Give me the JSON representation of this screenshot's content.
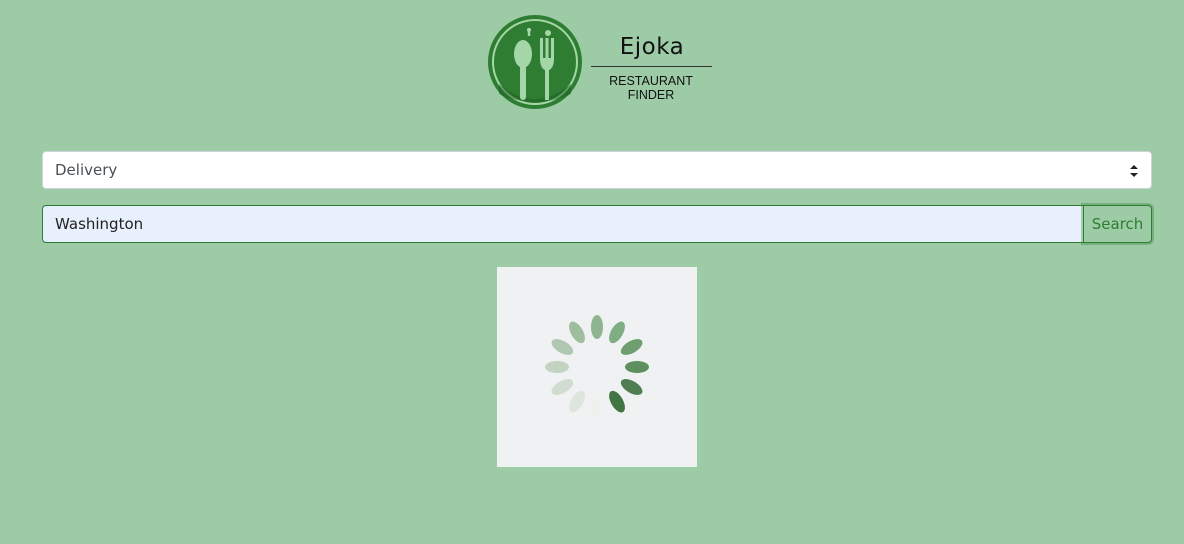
{
  "logo": {
    "title": "Ejoka",
    "subtitle": "RESTAURANT FINDER"
  },
  "filter": {
    "selected": "Delivery"
  },
  "search": {
    "value": "Washington",
    "button_label": "Search"
  },
  "colors": {
    "background": "#9ccba6",
    "accent": "#2e7d32",
    "input_bg": "#e8f0fe",
    "loader_bg": "#f0f1f3"
  },
  "icons": {
    "logo": "spoon-fork-logo-icon",
    "select_arrow": "sort-arrows-icon",
    "spinner": "loading-spinner-icon"
  }
}
